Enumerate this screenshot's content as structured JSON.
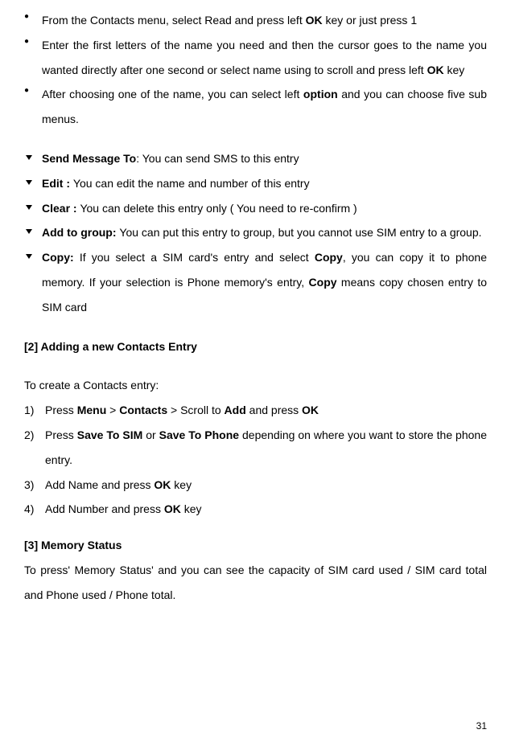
{
  "bullets": {
    "b1_a": "From the Contacts menu, select Read and press left ",
    "b1_b": "OK",
    "b1_c": " key or just press 1",
    "b2_a": "Enter the first letters of the name you need and then the cursor goes to the name you wanted directly after one second or select name using to scroll and press left ",
    "b2_b": "OK",
    "b2_c": " key",
    "b3_a": "After choosing one of the name, you can select left ",
    "b3_b": "option",
    "b3_c": " and you can choose five sub menus."
  },
  "arrows": {
    "a1_a": "Send Message To",
    "a1_b": ": You can send SMS to this entry",
    "a2_a": "Edit : ",
    "a2_b": "You can edit the name and number of this entry",
    "a3_a": "Clear : ",
    "a3_b": "You can delete this entry only ( You need to re-confirm )",
    "a4_a": "Add to group: ",
    "a4_b": "You can put this entry to group, but you cannot use SIM entry to a group.",
    "a5_a": "Copy: ",
    "a5_b": "If you select a SIM card's entry and select ",
    "a5_c": "Copy",
    "a5_d": ", you can copy it to phone memory. If your selection is Phone memory's entry, ",
    "a5_e": "Copy",
    "a5_f": " means copy chosen entry to SIM card"
  },
  "section2": {
    "heading": "[2]        Adding a new Contacts Entry",
    "intro": "To create a Contacts entry:",
    "s1_a": "Press ",
    "s1_b": "Menu",
    "s1_c": " > ",
    "s1_d": "Contacts",
    "s1_e": " > Scroll to ",
    "s1_f": "Add",
    "s1_g": " and press ",
    "s1_h": "OK",
    "s2_a": "Press ",
    "s2_b": "Save To SIM",
    "s2_c": " or ",
    "s2_d": "Save To Phone",
    "s2_e": " depending on where you want to store the phone entry.",
    "s3_a": "Add Name and press ",
    "s3_b": "OK",
    "s3_c": " key",
    "s4_a": "Add Number and press ",
    "s4_b": "OK",
    "s4_c": " key",
    "n1": "1)",
    "n2": "2)",
    "n3": "3)",
    "n4": "4)"
  },
  "section3": {
    "heading": "[3]        Memory Status",
    "body": "To press' Memory Status' and you can see the capacity of SIM card used / SIM card total and Phone used / Phone total."
  },
  "pageNumber": "31"
}
